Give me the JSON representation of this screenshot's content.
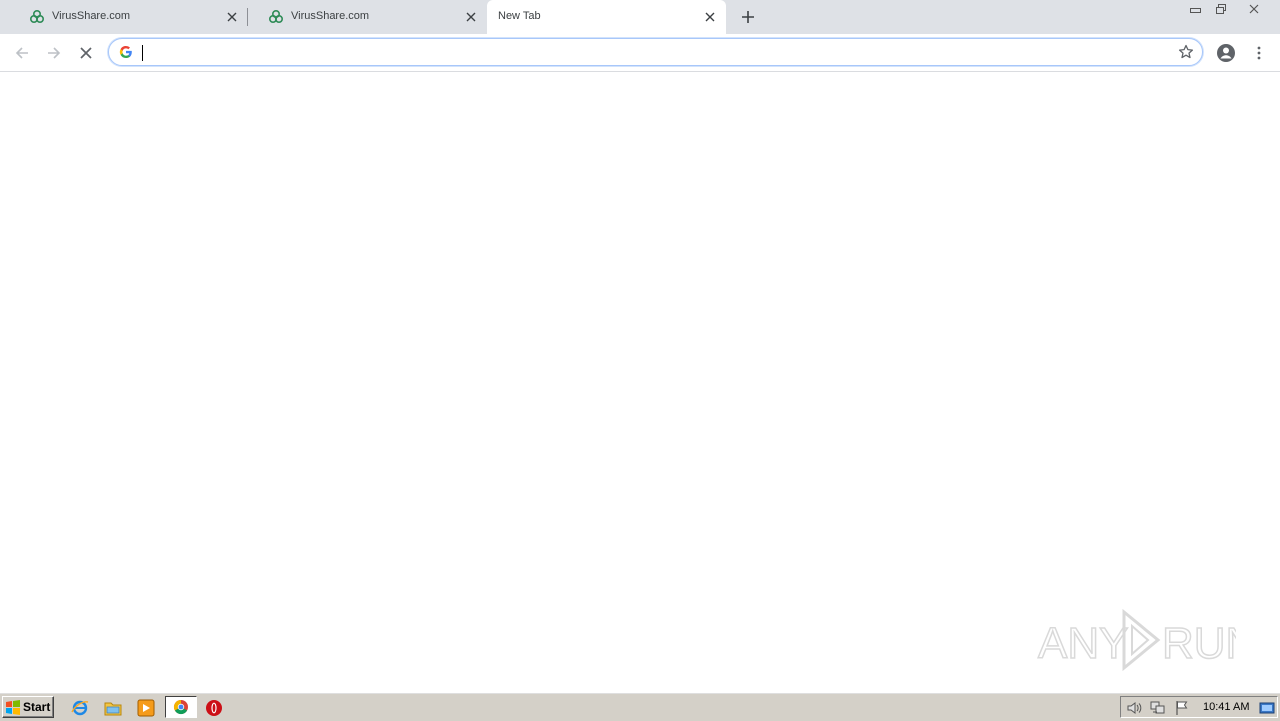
{
  "browser": {
    "tabs": [
      {
        "title": "VirusShare.com",
        "active": false,
        "favicon": "biohazard-icon"
      },
      {
        "title": "VirusShare.com",
        "active": false,
        "favicon": "biohazard-icon"
      },
      {
        "title": "New Tab",
        "active": true,
        "favicon": "none"
      }
    ],
    "omnibox": {
      "value": "",
      "placeholder": ""
    },
    "colors": {
      "tabstrip": "#dee1e6",
      "omnibox_border": "#a8c7fa",
      "favicon_green": "#2e8b57"
    }
  },
  "watermark": {
    "text": "ANY RUN"
  },
  "taskbar": {
    "start_label": "Start",
    "quick_launch": [
      "ie-icon",
      "folder-icon",
      "media-player-icon",
      "chrome-icon",
      "opera-icon"
    ],
    "tray": {
      "time": "10:41 AM"
    }
  }
}
